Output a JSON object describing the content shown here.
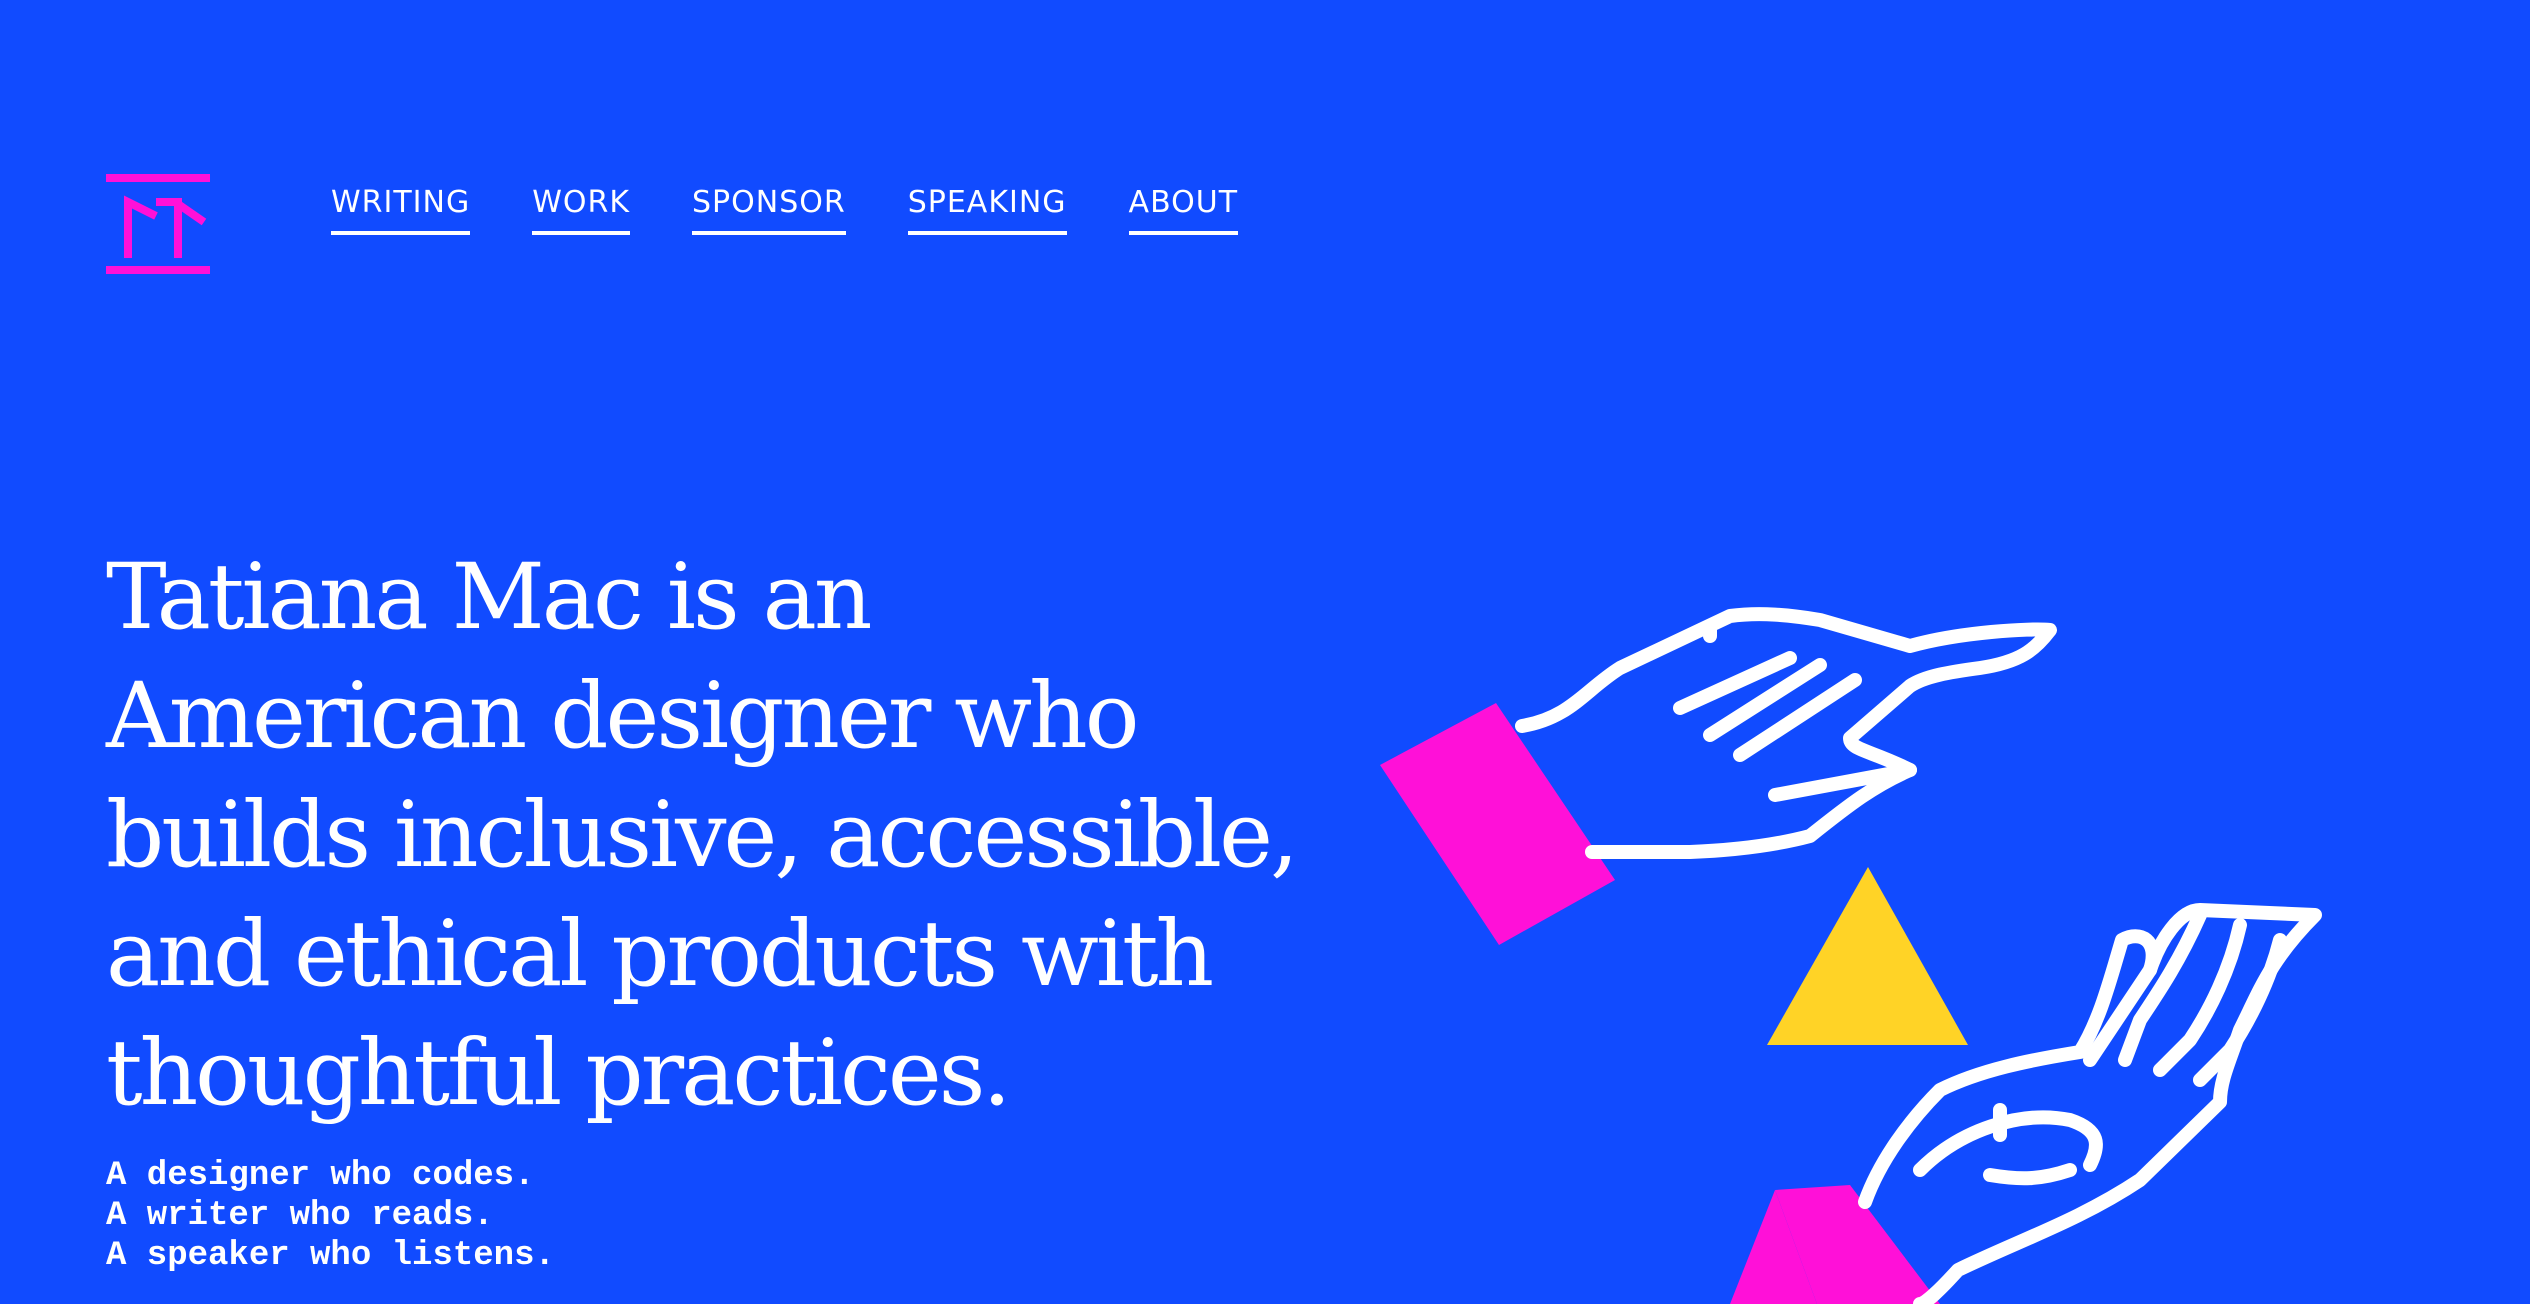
{
  "header": {
    "nav": [
      {
        "label": "WRITING"
      },
      {
        "label": "WORK"
      },
      {
        "label": "SPONSOR"
      },
      {
        "label": "SPEAKING"
      },
      {
        "label": "ABOUT"
      }
    ]
  },
  "hero": {
    "headline": "Tatiana Mac is an American designer who builds inclusive, accessible, and ethical products with thoughtful practices.",
    "taglines": [
      "A designer who codes.",
      "A writer who reads.",
      "A speaker who listens."
    ]
  },
  "icons": {
    "logo": "tm-monogram-logo",
    "illustration": "hands-with-triangle-illustration"
  },
  "colors": {
    "background": "#114BFF",
    "accent_magenta": "#FF10D8",
    "accent_yellow": "#FFD326",
    "text": "#FFFFFF"
  }
}
